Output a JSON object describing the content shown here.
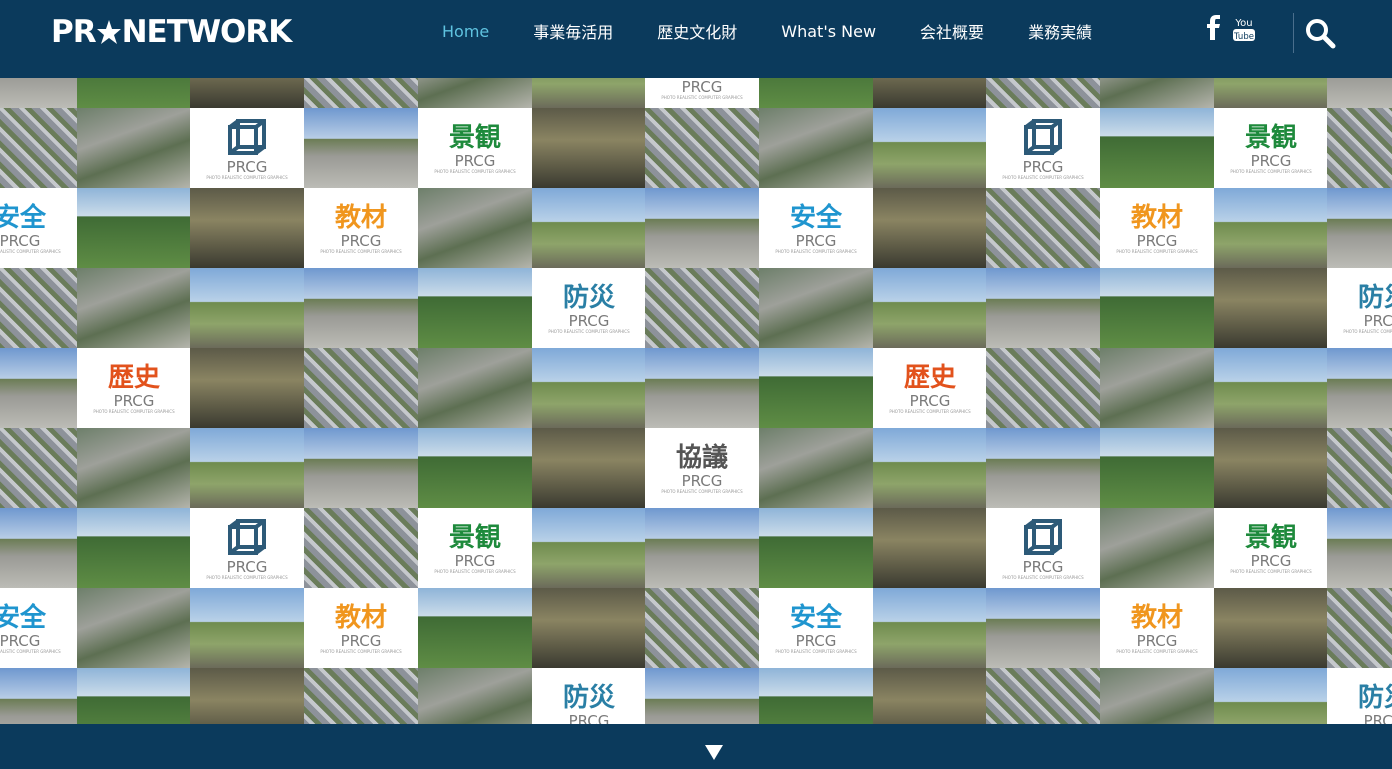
{
  "header": {
    "logo_text_left": "PR",
    "logo_text_right": "NETWORK",
    "nav": [
      {
        "label": "Home",
        "active": true
      },
      {
        "label": "事業毎活用",
        "active": false
      },
      {
        "label": "歴史文化財",
        "active": false
      },
      {
        "label": "What's New",
        "active": false
      },
      {
        "label": "会社概要",
        "active": false
      },
      {
        "label": "業務実績",
        "active": false
      }
    ],
    "social": [
      {
        "icon": "facebook-icon",
        "text": "f"
      },
      {
        "icon": "youtube-icon",
        "text": "You Tube"
      }
    ],
    "search_icon": "search-icon"
  },
  "tiles": {
    "prcg_text": "PRCG",
    "prcg_sub": "PHOTO REALISTIC COMPUTER GRAPHICS",
    "labels": {
      "keikan": {
        "text": "景観",
        "color": "#1e8a3c"
      },
      "anzen": {
        "text": "安全",
        "color": "#1f95cf"
      },
      "kyozai": {
        "text": "教材",
        "color": "#f0961e"
      },
      "bousai": {
        "text": "防災",
        "color": "#2a7fa5"
      },
      "rekishi": {
        "text": "歴史",
        "color": "#e2521c"
      },
      "kyougi": {
        "text": "協議",
        "color": "#555555"
      }
    }
  },
  "colors": {
    "header_bg": "#0b3a5c",
    "nav_active": "#5fc3e0"
  },
  "footer": {
    "scroll_icon": "scroll-down-arrow-icon"
  }
}
